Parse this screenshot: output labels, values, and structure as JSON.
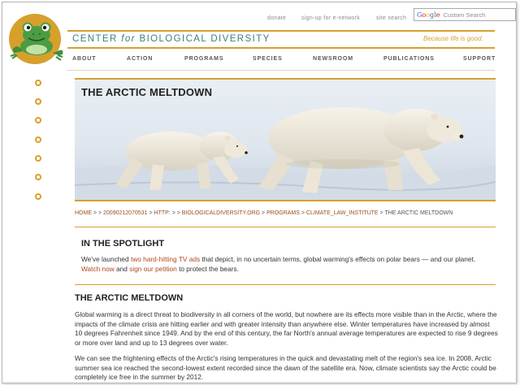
{
  "utility_nav": {
    "donate": "donate",
    "signup": "sign-up for e-network",
    "site_search": "site search"
  },
  "search": {
    "google_label": "Google",
    "placeholder": "Custom Search"
  },
  "header": {
    "org_part1": "CENTER ",
    "org_for": "for",
    "org_part2": " BIOLOGICAL DIVERSITY",
    "tagline": "Because life is good."
  },
  "main_nav": [
    "ABOUT",
    "ACTION",
    "PROGRAMS",
    "SPECIES",
    "NEWSROOM",
    "PUBLICATIONS",
    "SUPPORT"
  ],
  "hero": {
    "title": "THE ARCTIC MELTDOWN"
  },
  "breadcrumb": {
    "items": [
      "HOME",
      "20090212070531",
      "HTTP:",
      "BIOLOGICALDIVERSITY.ORG",
      "PROGRAMS",
      "CLIMATE_LAW_INSTITUTE",
      "THE ARCTIC MELTDOWN"
    ]
  },
  "spotlight": {
    "heading": "IN THE SPOTLIGHT",
    "t1": "We've launched ",
    "link_ads": "two hard-hitting TV ads",
    "t2": " that depict, in no uncertain terms, global warming's effects on polar bears — and our planet. ",
    "link_watch": "Watch now",
    "t3": " and ",
    "link_petition": "sign our petition",
    "t4": " to protect the bears."
  },
  "article": {
    "heading": "THE ARCTIC MELTDOWN",
    "p1": "Global warming is a direct threat to biodiversity in all corners of the world, but nowhere are its effects more visible than in the Arctic, where the impacts of the climate crisis are hitting earlier and with greater intensity than anywhere else. Winter temperatures have increased by almost 10 degrees Fahrenheit since 1949. And by the end of this century, the far North's annual average temperatures are expected to rise 9 degrees or more over land and up to 13 degrees over water.",
    "p2": "We can see the frightening effects of the Arctic's rising temperatures in the quick and devastating melt of the region's sea ice. In 2008, Arctic summer sea ice reached the second-lowest extent recorded since the dawn of the satellite era. Now, climate scientists say the Arctic could be completely ice free in the summer by 2012."
  },
  "colors": {
    "gold": "#d7a02c",
    "teal": "#3d7f7a",
    "link": "#b0481a"
  }
}
